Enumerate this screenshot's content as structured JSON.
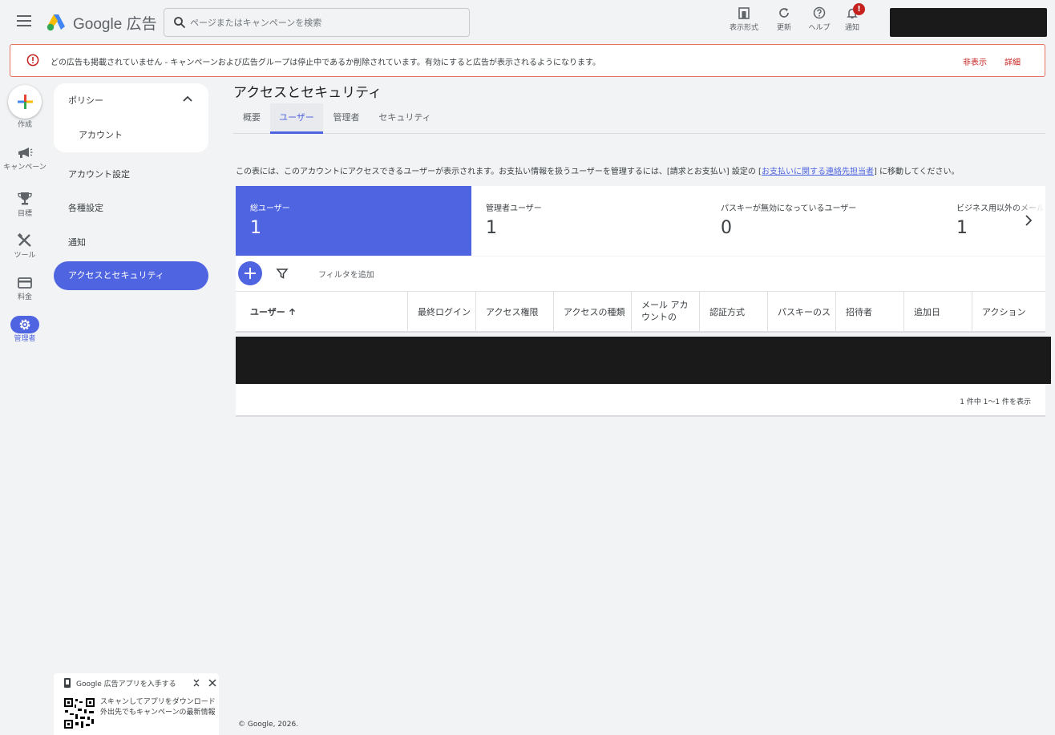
{
  "topbar": {
    "brand": "Google",
    "product": "広告",
    "search_placeholder": "ページまたはキャンペーンを検索",
    "tools": [
      {
        "label": "表示形式"
      },
      {
        "label": "更新"
      },
      {
        "label": "ヘルプ"
      },
      {
        "label": "通知"
      }
    ],
    "notification_badge": "!"
  },
  "alert": {
    "message": "どの広告も掲載されていません - キャンペーンおよび広告グループは停止中であるか削除されています。有効にすると広告が表示されるようになります。",
    "dismiss": "非表示",
    "details": "詳細"
  },
  "rail": {
    "create": "作成",
    "campaigns": "キャンペーン",
    "goals": "目標",
    "tools": "ツール",
    "billing": "料金",
    "admin": "管理者"
  },
  "sidenav": {
    "policy": "ポリシー",
    "account": "アカウント",
    "account_settings": "アカウント設定",
    "preferences": "各種設定",
    "notifications": "通知",
    "access_security": "アクセスとセキュリティ"
  },
  "promo": {
    "title": "Google 広告アプリを入手する",
    "line1": "スキャンしてアプリをダウンロード",
    "line2": "外出先でもキャンペーンの最新情報"
  },
  "main": {
    "title": "アクセスとセキュリティ",
    "tabs": [
      "概要",
      "ユーザー",
      "管理者",
      "セキュリティ"
    ],
    "active_tab": "ユーザー",
    "description_before": "この表には、このアカウントにアクセスできるユーザーが表示されます。お支払い情報を扱うユーザーを管理するには、[請求とお支払い] 設定の [",
    "description_link": "お支払いに関する連絡先担当者",
    "description_after": "] に移動してください。",
    "stats": [
      {
        "label": "総ユーザー",
        "value": "1"
      },
      {
        "label": "管理者ユーザー",
        "value": "1"
      },
      {
        "label": "パスキーが無効になっているユーザー",
        "value": "0"
      },
      {
        "label": "ビジネス用以外のメールア",
        "value": "1"
      }
    ],
    "filter_label": "フィルタを追加",
    "columns": [
      "ユーザー",
      "最終ログイン",
      "アクセス権限",
      "アクセスの種類",
      "メール アカウントの",
      "認証方式",
      "パスキーのス",
      "招待者",
      "追加日",
      "アクション"
    ],
    "pagination": "1 件中 1〜1 件を表示"
  },
  "footer": "© Google, 2026.",
  "colors": {
    "accent": "#4f64e0",
    "alert_border": "#e8715f",
    "alert_link": "#c5221f",
    "background": "#f1f3f4"
  }
}
